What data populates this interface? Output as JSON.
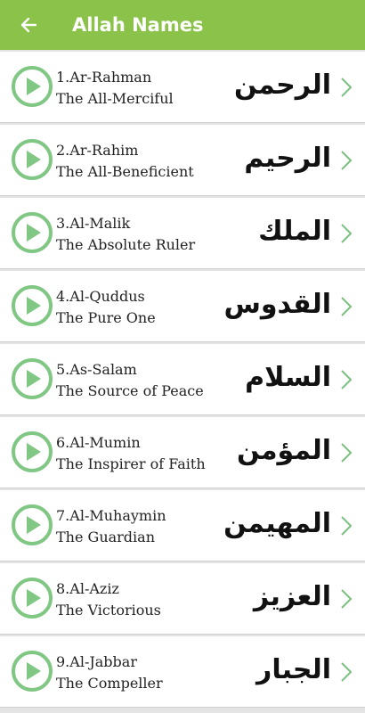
{
  "header": {
    "title": "Allah Names"
  },
  "items": [
    {
      "name": "1.Ar-Rahman",
      "meaning": "The All-Merciful",
      "arabic": "الرحمن"
    },
    {
      "name": "2.Ar-Rahim",
      "meaning": "The All-Beneficient",
      "arabic": "الرحيم"
    },
    {
      "name": "3.Al-Malik",
      "meaning": "The Absolute Ruler",
      "arabic": "الملك"
    },
    {
      "name": "4.Al-Quddus",
      "meaning": "The Pure One",
      "arabic": "القدوس"
    },
    {
      "name": "5.As-Salam",
      "meaning": "The Source of Peace",
      "arabic": "السلام"
    },
    {
      "name": "6.Al-Mumin",
      "meaning": "The Inspirer of Faith",
      "arabic": "المؤمن"
    },
    {
      "name": "7.Al-Muhaymin",
      "meaning": "The Guardian",
      "arabic": "المهيمن"
    },
    {
      "name": "8.Al-Aziz",
      "meaning": "The Victorious",
      "arabic": "العزيز"
    },
    {
      "name": "9.Al-Jabbar",
      "meaning": "The Compeller",
      "arabic": "الجبار"
    }
  ],
  "colors": {
    "appbar": "#8bc34a",
    "play": "#80c784",
    "chevron": "#7cc07f"
  },
  "icons": {
    "back": "arrow-back-icon",
    "play": "play-circle-icon",
    "chevron": "chevron-right-icon"
  }
}
